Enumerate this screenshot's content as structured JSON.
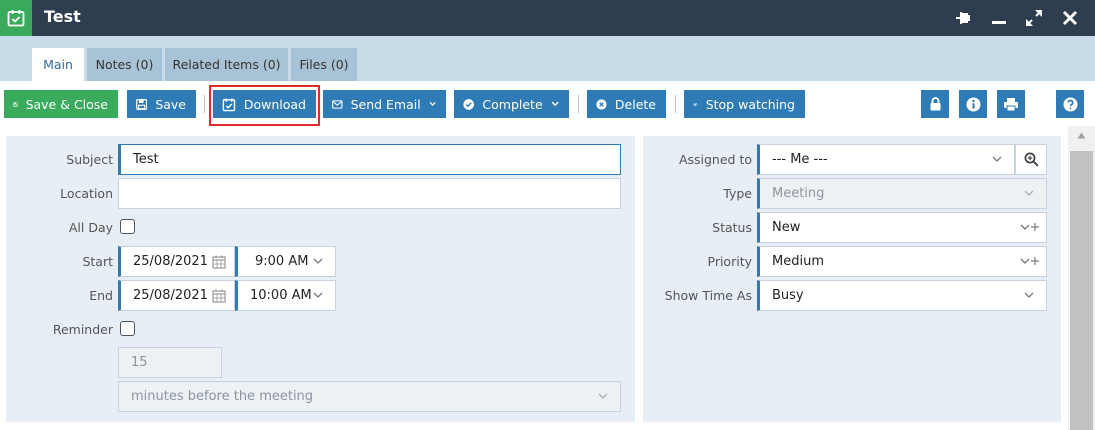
{
  "window": {
    "title": "Test"
  },
  "tabs": [
    {
      "label": "Main"
    },
    {
      "label": "Notes (0)"
    },
    {
      "label": "Related Items (0)"
    },
    {
      "label": "Files (0)"
    }
  ],
  "toolbar": {
    "save_close": "Save & Close",
    "save": "Save",
    "download": "Download",
    "send_email": "Send Email",
    "complete": "Complete",
    "delete": "Delete",
    "stop_watching": "Stop watching"
  },
  "form": {
    "subject": {
      "label": "Subject",
      "value": "Test"
    },
    "location": {
      "label": "Location",
      "value": ""
    },
    "all_day": {
      "label": "All Day",
      "checked": false
    },
    "start": {
      "label": "Start",
      "date": "25/08/2021",
      "time": "9:00 AM"
    },
    "end": {
      "label": "End",
      "date": "25/08/2021",
      "time": "10:00 AM"
    },
    "reminder": {
      "label": "Reminder",
      "checked": false,
      "amount": "15",
      "unit": "minutes before the meeting"
    },
    "assigned_to": {
      "label": "Assigned to",
      "value": "--- Me ---"
    },
    "type": {
      "label": "Type",
      "value": "Meeting"
    },
    "status": {
      "label": "Status",
      "value": "New"
    },
    "priority": {
      "label": "Priority",
      "value": "Medium"
    },
    "show_time_as": {
      "label": "Show Time As",
      "value": "Busy"
    }
  },
  "colors": {
    "titlebar": "#2e3e50",
    "accent_green": "#3aaa5c",
    "accent_blue": "#2e7bb5",
    "highlight": "#e02b2b"
  }
}
